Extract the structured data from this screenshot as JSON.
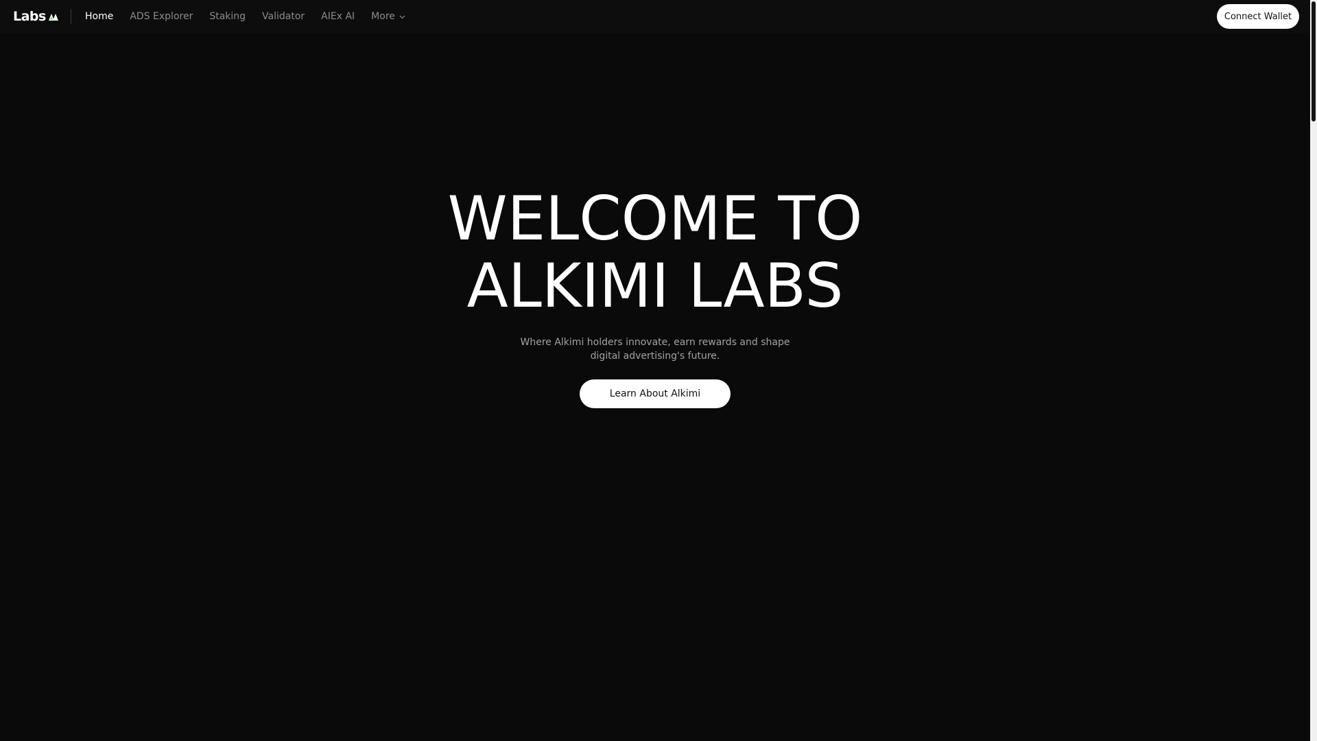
{
  "nav": {
    "logo_text": "Labs",
    "links": [
      {
        "label": "Home",
        "active": true
      },
      {
        "label": "ADS Explorer",
        "active": false
      },
      {
        "label": "Staking",
        "active": false
      },
      {
        "label": "Validator",
        "active": false
      },
      {
        "label": "AIEx AI",
        "active": false
      },
      {
        "label": "More",
        "active": false,
        "has_dropdown": true
      }
    ],
    "connect_wallet_label": "Connect Wallet"
  },
  "hero": {
    "title_line1": "WELCOME TO",
    "title_line2": "ALKIMI LABS",
    "subtitle": "Where Alkimi holders innovate, earn rewards and shape digital advertising's future.",
    "cta_label": "Learn About Alkimi"
  },
  "icons": {
    "logo_mark": "triangle-logo-icon",
    "more_chevron": "chevron-down-icon"
  },
  "colors": {
    "background": "#0a0a0a",
    "navbar": "#0d0d0d",
    "text_primary": "#ffffff",
    "text_muted": "#8c8c8c",
    "button_bg": "#ffffff",
    "button_text": "#111111"
  }
}
